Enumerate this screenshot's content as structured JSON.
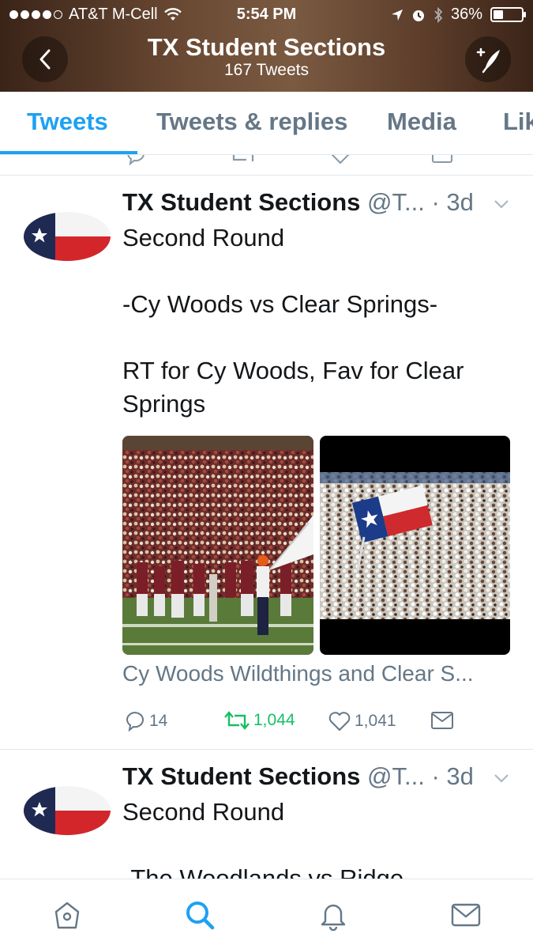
{
  "status_bar": {
    "carrier": "AT&T M-Cell",
    "time": "5:54 PM",
    "battery": "36%",
    "battery_level": 0.36
  },
  "header": {
    "title": "TX Student Sections",
    "subtitle": "167 Tweets"
  },
  "tabs": [
    {
      "label": "Tweets",
      "active": true
    },
    {
      "label": "Tweets & replies"
    },
    {
      "label": "Media"
    },
    {
      "label": "Lik"
    }
  ],
  "tweets": [
    {
      "name": "TX Student Sections",
      "handle": "@T...",
      "time": "· 3d",
      "text": "Second Round\n\n-Cy Woods vs Clear Springs-\n\nRT for Cy Woods, Fav for Clear Springs",
      "media_caption": "Cy Woods Wildthings and Clear S...",
      "replies": "14",
      "retweets": "1,044",
      "likes": "1,041"
    },
    {
      "name": "TX Student Sections",
      "handle": "@T...",
      "time": "· 3d",
      "text": "Second Round\n\n-The Woodlands vs Ridge"
    }
  ],
  "colors": {
    "accent": "#1da1f2",
    "retweet": "#17bf63",
    "secondary_text": "#657786"
  },
  "icons": {
    "back": "chevron-left-icon",
    "compose": "compose-quill-icon",
    "reply": "reply-bubble-icon",
    "retweet": "retweet-icon",
    "like": "heart-icon",
    "dm": "envelope-icon",
    "home": "home-icon",
    "search": "search-icon",
    "notifications": "bell-icon",
    "messages": "envelope-icon"
  }
}
